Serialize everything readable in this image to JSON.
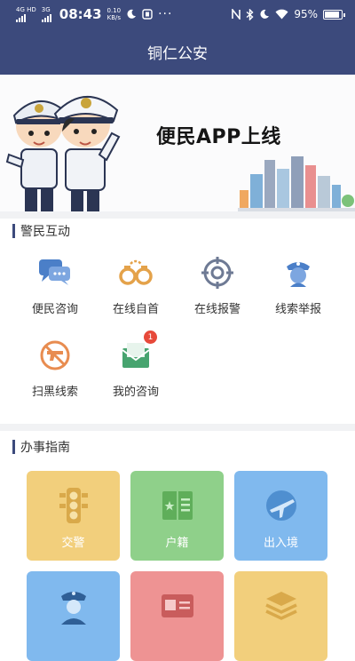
{
  "status_bar": {
    "network": "4G HD",
    "network2": "3G",
    "time": "08:43",
    "speed_value": "0.10",
    "speed_unit": "KB/s",
    "battery": "95%"
  },
  "app_bar": {
    "title": "铜仁公安"
  },
  "banner": {
    "title": "便民APP上线"
  },
  "section_interaction": {
    "title": "警民互动",
    "items": [
      {
        "label": "便民咨询",
        "icon": "chat-icon",
        "color": "#4b7fc8"
      },
      {
        "label": "在线自首",
        "icon": "handcuffs-icon",
        "color": "#e4a24a"
      },
      {
        "label": "在线报警",
        "icon": "target-icon",
        "color": "#6e7a94"
      },
      {
        "label": "线索举报",
        "icon": "police-officer-icon",
        "color": "#4b7fc8"
      },
      {
        "label": "扫黑线索",
        "icon": "no-gun-icon",
        "color": "#e88c50"
      },
      {
        "label": "我的咨询",
        "icon": "mail-icon",
        "color": "#47a46f",
        "badge": "1"
      }
    ]
  },
  "section_guide": {
    "title": "办事指南",
    "tiles": [
      {
        "label": "交警",
        "icon": "traffic-light-icon",
        "color": "#f2cf7c"
      },
      {
        "label": "户籍",
        "icon": "household-register-icon",
        "color": "#8fd08a"
      },
      {
        "label": "出入境",
        "icon": "airplane-icon",
        "color": "#80b9ee"
      },
      {
        "label": "",
        "icon": "police-officer-icon",
        "color": "#80b9ee"
      },
      {
        "label": "",
        "icon": "id-card-icon",
        "color": "#ee9393"
      },
      {
        "label": "",
        "icon": "layers-icon",
        "color": "#f2cf7c"
      }
    ]
  }
}
